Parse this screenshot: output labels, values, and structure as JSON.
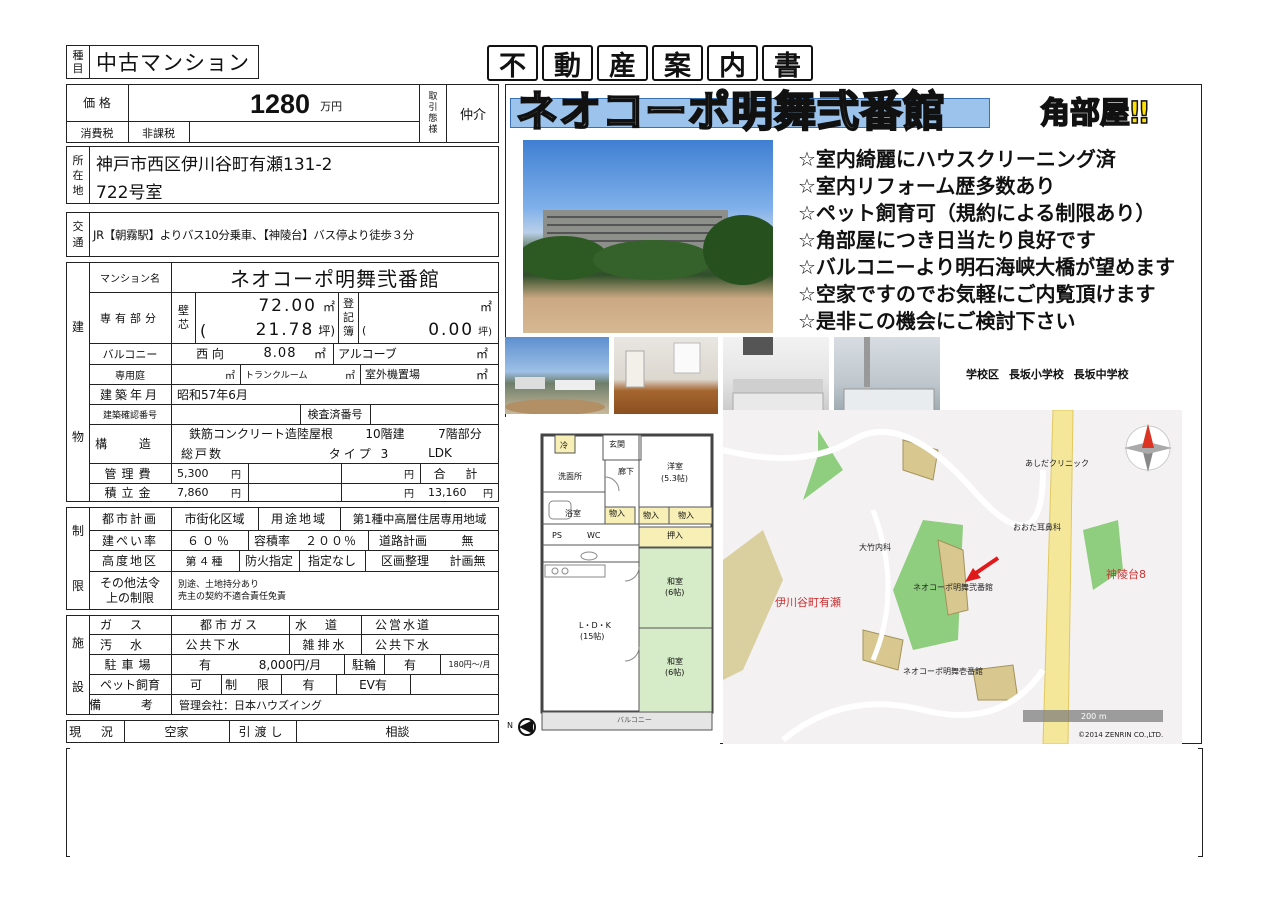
{
  "header": {
    "type_label_chars": [
      "種",
      "目"
    ],
    "property_type": "中古マンション",
    "title_chars": [
      "不",
      "動",
      "産",
      "案",
      "内",
      "書"
    ]
  },
  "price": {
    "label": "価 格",
    "value": "1280",
    "unit": "万円",
    "tax_label": "消費税",
    "tax_value": "非課税",
    "deal_type_label_chars": [
      "取",
      "引",
      "態",
      "様"
    ],
    "deal_type": "仲介"
  },
  "location": {
    "label_chars": [
      "所",
      "在",
      "地"
    ],
    "line1": "神戸市西区伊川谷町有瀬131-2",
    "line2": "722号室"
  },
  "transport": {
    "label_chars": [
      "交",
      "通"
    ],
    "text": "JR【朝霧駅】よりバス10分乗車、【神陵台】バス停より徒歩３分"
  },
  "building": {
    "section_label_chars": [
      "建",
      "物"
    ],
    "name_label": "マンション名",
    "name": "ネオコーポ明舞弐番館",
    "area_label": "専有部分",
    "wall_label_chars": [
      "壁",
      "芯"
    ],
    "area_sqm": "72.00",
    "sqm_unit": "㎡",
    "area_tsubo": "21.78",
    "tsubo_unit": "坪)",
    "paren_open": "(",
    "registry_label_chars": [
      "登",
      "記",
      "簿"
    ],
    "registry_sqm": "",
    "registry_tsubo": "0.00",
    "registry_tsubo_unit": "坪)",
    "balcony_label": "バルコニー",
    "balcony_dir": "西 向",
    "balcony_area": "8.08",
    "alcove_label": "アルコーブ",
    "garden_label": "専用庭",
    "trunk_label": "トランクルーム",
    "outdoor_unit_label": "室外機置場",
    "built_label": "建築年月",
    "built_value": "昭和57年6月",
    "confirm_label": "建築確認番号",
    "inspect_label": "検査済番号",
    "structure_label": "構 造",
    "structure_value": "鉄筋コンクリート造陸屋根",
    "floors": "10階建",
    "floor_part": "7階部分",
    "total_units_label": "総戸数",
    "layout_type_label": "タイプ 3",
    "layout": "LDK",
    "mgmt_fee_label": "管理費",
    "mgmt_fee": "5,300",
    "reserve_label": "積立金",
    "reserve_fee": "7,860",
    "yen": "円",
    "total_label": "合 計",
    "total": "13,160"
  },
  "restrictions": {
    "section_label_chars": [
      "制",
      "限"
    ],
    "city_plan_label": "都市計画",
    "city_plan": "市街化区域",
    "zoning_label": "用途地域",
    "zoning": "第1種中高層住居専用地域",
    "bcr_label": "建ぺい率",
    "bcr": "６０％",
    "far_label": "容積率",
    "far": "２００％",
    "road_label": "道路計画",
    "road": "無",
    "height_label": "高度地区",
    "height": "第４種",
    "fire_label": "防火指定",
    "fire": "指定なし",
    "land_label": "区画整理",
    "land": "計画無",
    "other_label_1": "その他法令",
    "other_label_2": "上の制限",
    "other_text_1": "別途、土地持分あり",
    "other_text_2": "売主の契約不適合責任免責"
  },
  "facilities": {
    "section_label_chars": [
      "施",
      "設"
    ],
    "gas_label": "ガス",
    "gas": "都市ガス",
    "water_label": "水道",
    "water": "公営水道",
    "sewage_label": "汚水",
    "sewage": "公共下水",
    "drain_label": "雑排水",
    "drain": "公共下水",
    "parking_label": "駐車場",
    "parking": "有",
    "parking_fee": "8,000円/月",
    "bike_label": "駐輪",
    "bike": "有",
    "bike_fee": "180円～/月",
    "pet_label": "ペット飼育",
    "pet": "可",
    "limit_label": "制 限",
    "limit": "有",
    "ev": "EV有",
    "note_label": "備 考",
    "note": "管理会社：日本ハウズイング"
  },
  "status": {
    "label": "現 況",
    "value": "空家",
    "handover_label": "引渡し",
    "handover": "相談"
  },
  "promo": {
    "banner": "ネオコーポ明舞弐番館",
    "corner": "角部屋‼",
    "points": [
      "☆室内綺麗にハウスクリーニング済",
      "☆室内リフォーム歴多数あり",
      "☆ペット飼育可（規約による制限あり）",
      "☆角部屋につき日当たり良好です",
      "☆バルコニーより明石海峡大橋が望めます",
      "☆空家ですのでお気軽にご内覧頂けます",
      "☆是非この機会にご検討下さい"
    ],
    "school": "学校区 長坂小学校 長坂中学校"
  },
  "floorplan": {
    "entrance": "玄関",
    "hall": "廊下",
    "western": "洋室",
    "western_size": "(5.3帖)",
    "washroom": "洗面所",
    "bath": "浴室",
    "closet": "物入",
    "ps": "PS",
    "wc": "WC",
    "oshiire": "押入",
    "japanese1": "和室",
    "japanese1_size": "(6帖)",
    "ldk": "L・D・K",
    "ldk_size": "(15帖)",
    "japanese2": "和室",
    "japanese2_size": "(6帖)",
    "balcony": "バルコニー",
    "north": "N",
    "fridge_label": "冷"
  },
  "map": {
    "label_area": "伊川谷町有瀬",
    "label_target": "ネオコーポ明舞弐番館",
    "label_other": "ネオコーポ明舞壱番館",
    "label_kindergarten": "大竹内科",
    "label_clinic1": "あしだクリニック",
    "label_clinic2": "おおた耳鼻科",
    "label_town": "神陵台8",
    "scale": "200 m",
    "copyright": "©2014 ZENRIN CO.,LTD."
  },
  "colors": {
    "banner_bg": "#7fb2e5",
    "banner_text": "#ffffff",
    "corner_text": "#ffe100",
    "map_green": "#8fce7f",
    "map_road": "#f5e79a",
    "map_building": "#d8c88f",
    "map_arrow": "#e0191b"
  }
}
